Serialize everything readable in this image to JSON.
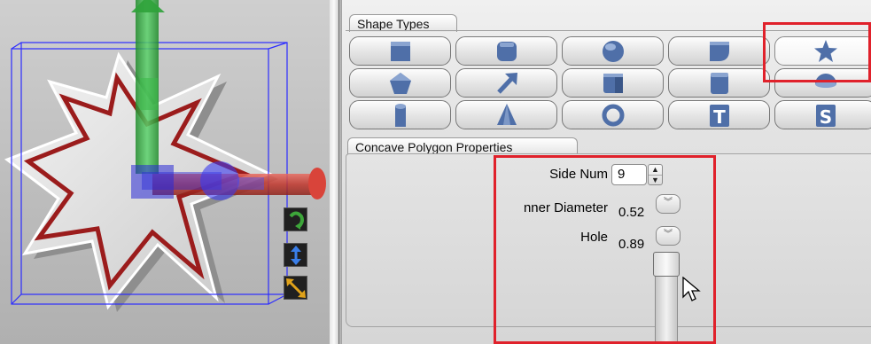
{
  "shape_types": {
    "title": "Shape Types",
    "buttons": [
      [
        "cube-shape-icon",
        "rounded-cube-shape-icon",
        "sphere-shape-icon",
        "quarter-cylinder-shape-icon",
        "star-shape-icon"
      ],
      [
        "pentagon-shape-icon",
        "arrow-shape-icon",
        "chamfer-box-shape-icon",
        "bevel-box-shape-icon",
        "hemisphere-shape-icon"
      ],
      [
        "cylinder-shape-icon",
        "cone-shape-icon",
        "torus-shape-icon",
        "text-t-shape-icon",
        "text-s-shape-icon"
      ]
    ],
    "selected": "star-shape-icon",
    "text_t": "T",
    "text_s": "S"
  },
  "properties": {
    "title": "Concave Polygon Properties",
    "side_num_label": "Side Num",
    "side_num_value": "9",
    "inner_diameter_label": "nner Diameter",
    "inner_diameter_value": "0.52",
    "hole_label": "Hole",
    "hole_value": "0.89"
  },
  "colors": {
    "highlight": "#e0212b",
    "shape_blue": "#4f6fa8",
    "star_outline": "#9b1c1c",
    "gizmo_green": "#2fa23a",
    "gizmo_blue": "#2a2ad6",
    "gizmo_red": "#d9443a"
  }
}
